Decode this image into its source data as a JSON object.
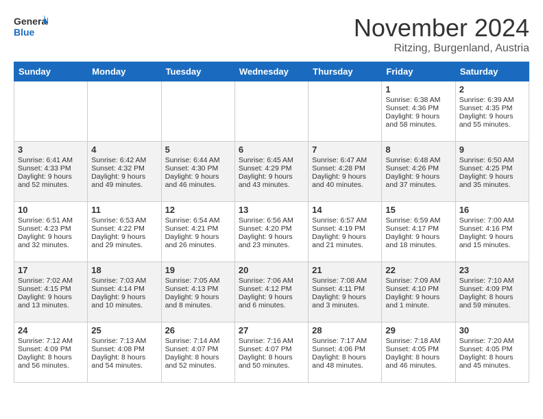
{
  "logo": {
    "line1": "General",
    "line2": "Blue"
  },
  "title": "November 2024",
  "location": "Ritzing, Burgenland, Austria",
  "days_of_week": [
    "Sunday",
    "Monday",
    "Tuesday",
    "Wednesday",
    "Thursday",
    "Friday",
    "Saturday"
  ],
  "weeks": [
    [
      {
        "day": "",
        "content": ""
      },
      {
        "day": "",
        "content": ""
      },
      {
        "day": "",
        "content": ""
      },
      {
        "day": "",
        "content": ""
      },
      {
        "day": "",
        "content": ""
      },
      {
        "day": "1",
        "content": "Sunrise: 6:38 AM\nSunset: 4:36 PM\nDaylight: 9 hours\nand 58 minutes."
      },
      {
        "day": "2",
        "content": "Sunrise: 6:39 AM\nSunset: 4:35 PM\nDaylight: 9 hours\nand 55 minutes."
      }
    ],
    [
      {
        "day": "3",
        "content": "Sunrise: 6:41 AM\nSunset: 4:33 PM\nDaylight: 9 hours\nand 52 minutes."
      },
      {
        "day": "4",
        "content": "Sunrise: 6:42 AM\nSunset: 4:32 PM\nDaylight: 9 hours\nand 49 minutes."
      },
      {
        "day": "5",
        "content": "Sunrise: 6:44 AM\nSunset: 4:30 PM\nDaylight: 9 hours\nand 46 minutes."
      },
      {
        "day": "6",
        "content": "Sunrise: 6:45 AM\nSunset: 4:29 PM\nDaylight: 9 hours\nand 43 minutes."
      },
      {
        "day": "7",
        "content": "Sunrise: 6:47 AM\nSunset: 4:28 PM\nDaylight: 9 hours\nand 40 minutes."
      },
      {
        "day": "8",
        "content": "Sunrise: 6:48 AM\nSunset: 4:26 PM\nDaylight: 9 hours\nand 37 minutes."
      },
      {
        "day": "9",
        "content": "Sunrise: 6:50 AM\nSunset: 4:25 PM\nDaylight: 9 hours\nand 35 minutes."
      }
    ],
    [
      {
        "day": "10",
        "content": "Sunrise: 6:51 AM\nSunset: 4:23 PM\nDaylight: 9 hours\nand 32 minutes."
      },
      {
        "day": "11",
        "content": "Sunrise: 6:53 AM\nSunset: 4:22 PM\nDaylight: 9 hours\nand 29 minutes."
      },
      {
        "day": "12",
        "content": "Sunrise: 6:54 AM\nSunset: 4:21 PM\nDaylight: 9 hours\nand 26 minutes."
      },
      {
        "day": "13",
        "content": "Sunrise: 6:56 AM\nSunset: 4:20 PM\nDaylight: 9 hours\nand 23 minutes."
      },
      {
        "day": "14",
        "content": "Sunrise: 6:57 AM\nSunset: 4:19 PM\nDaylight: 9 hours\nand 21 minutes."
      },
      {
        "day": "15",
        "content": "Sunrise: 6:59 AM\nSunset: 4:17 PM\nDaylight: 9 hours\nand 18 minutes."
      },
      {
        "day": "16",
        "content": "Sunrise: 7:00 AM\nSunset: 4:16 PM\nDaylight: 9 hours\nand 15 minutes."
      }
    ],
    [
      {
        "day": "17",
        "content": "Sunrise: 7:02 AM\nSunset: 4:15 PM\nDaylight: 9 hours\nand 13 minutes."
      },
      {
        "day": "18",
        "content": "Sunrise: 7:03 AM\nSunset: 4:14 PM\nDaylight: 9 hours\nand 10 minutes."
      },
      {
        "day": "19",
        "content": "Sunrise: 7:05 AM\nSunset: 4:13 PM\nDaylight: 9 hours\nand 8 minutes."
      },
      {
        "day": "20",
        "content": "Sunrise: 7:06 AM\nSunset: 4:12 PM\nDaylight: 9 hours\nand 6 minutes."
      },
      {
        "day": "21",
        "content": "Sunrise: 7:08 AM\nSunset: 4:11 PM\nDaylight: 9 hours\nand 3 minutes."
      },
      {
        "day": "22",
        "content": "Sunrise: 7:09 AM\nSunset: 4:10 PM\nDaylight: 9 hours\nand 1 minute."
      },
      {
        "day": "23",
        "content": "Sunrise: 7:10 AM\nSunset: 4:09 PM\nDaylight: 8 hours\nand 59 minutes."
      }
    ],
    [
      {
        "day": "24",
        "content": "Sunrise: 7:12 AM\nSunset: 4:09 PM\nDaylight: 8 hours\nand 56 minutes."
      },
      {
        "day": "25",
        "content": "Sunrise: 7:13 AM\nSunset: 4:08 PM\nDaylight: 8 hours\nand 54 minutes."
      },
      {
        "day": "26",
        "content": "Sunrise: 7:14 AM\nSunset: 4:07 PM\nDaylight: 8 hours\nand 52 minutes."
      },
      {
        "day": "27",
        "content": "Sunrise: 7:16 AM\nSunset: 4:07 PM\nDaylight: 8 hours\nand 50 minutes."
      },
      {
        "day": "28",
        "content": "Sunrise: 7:17 AM\nSunset: 4:06 PM\nDaylight: 8 hours\nand 48 minutes."
      },
      {
        "day": "29",
        "content": "Sunrise: 7:18 AM\nSunset: 4:05 PM\nDaylight: 8 hours\nand 46 minutes."
      },
      {
        "day": "30",
        "content": "Sunrise: 7:20 AM\nSunset: 4:05 PM\nDaylight: 8 hours\nand 45 minutes."
      }
    ]
  ]
}
